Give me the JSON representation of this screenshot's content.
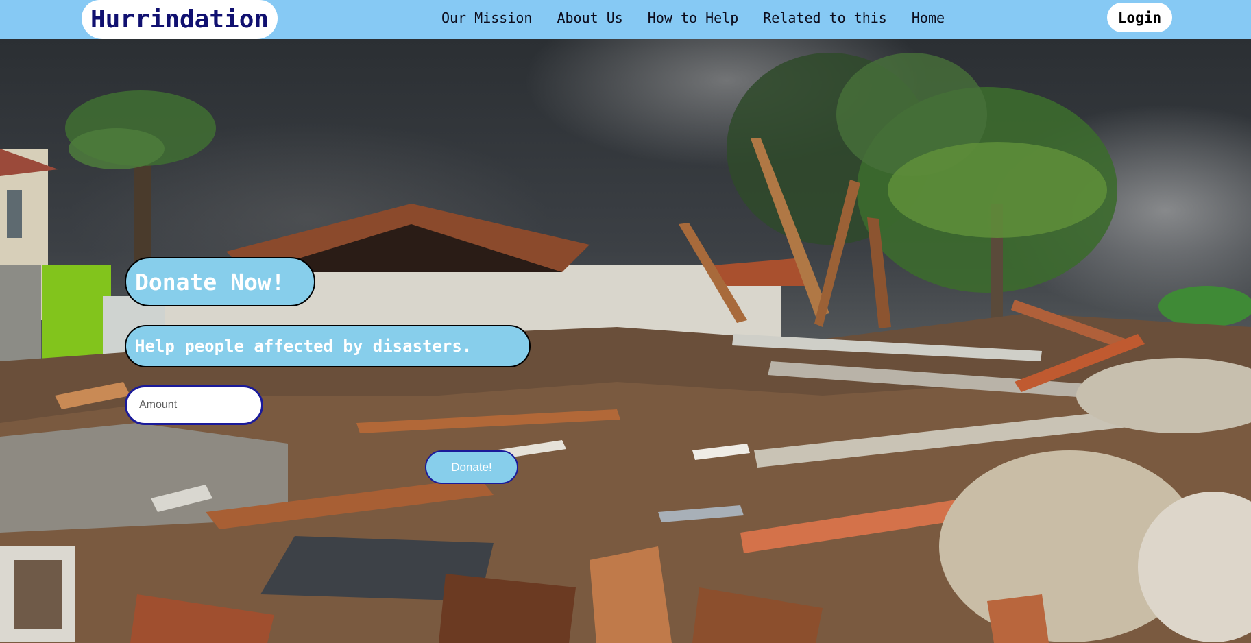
{
  "brand": {
    "name": "Hurrindation",
    "accent_color": "#86c9f4",
    "logo_text_color": "#101070"
  },
  "nav": {
    "links": [
      "Our Mission",
      "About Us",
      "How to Help",
      "Related to this",
      "Home"
    ],
    "login_label": "Login"
  },
  "hero": {
    "image_subject": "hurricane-destroyed-house-debris",
    "donate_title": "Donate Now!",
    "donate_subtitle": "Help people affected by disasters.",
    "amount_placeholder": "Amount",
    "donate_button_label": "Donate!",
    "pill_color": "#87ceeb"
  }
}
